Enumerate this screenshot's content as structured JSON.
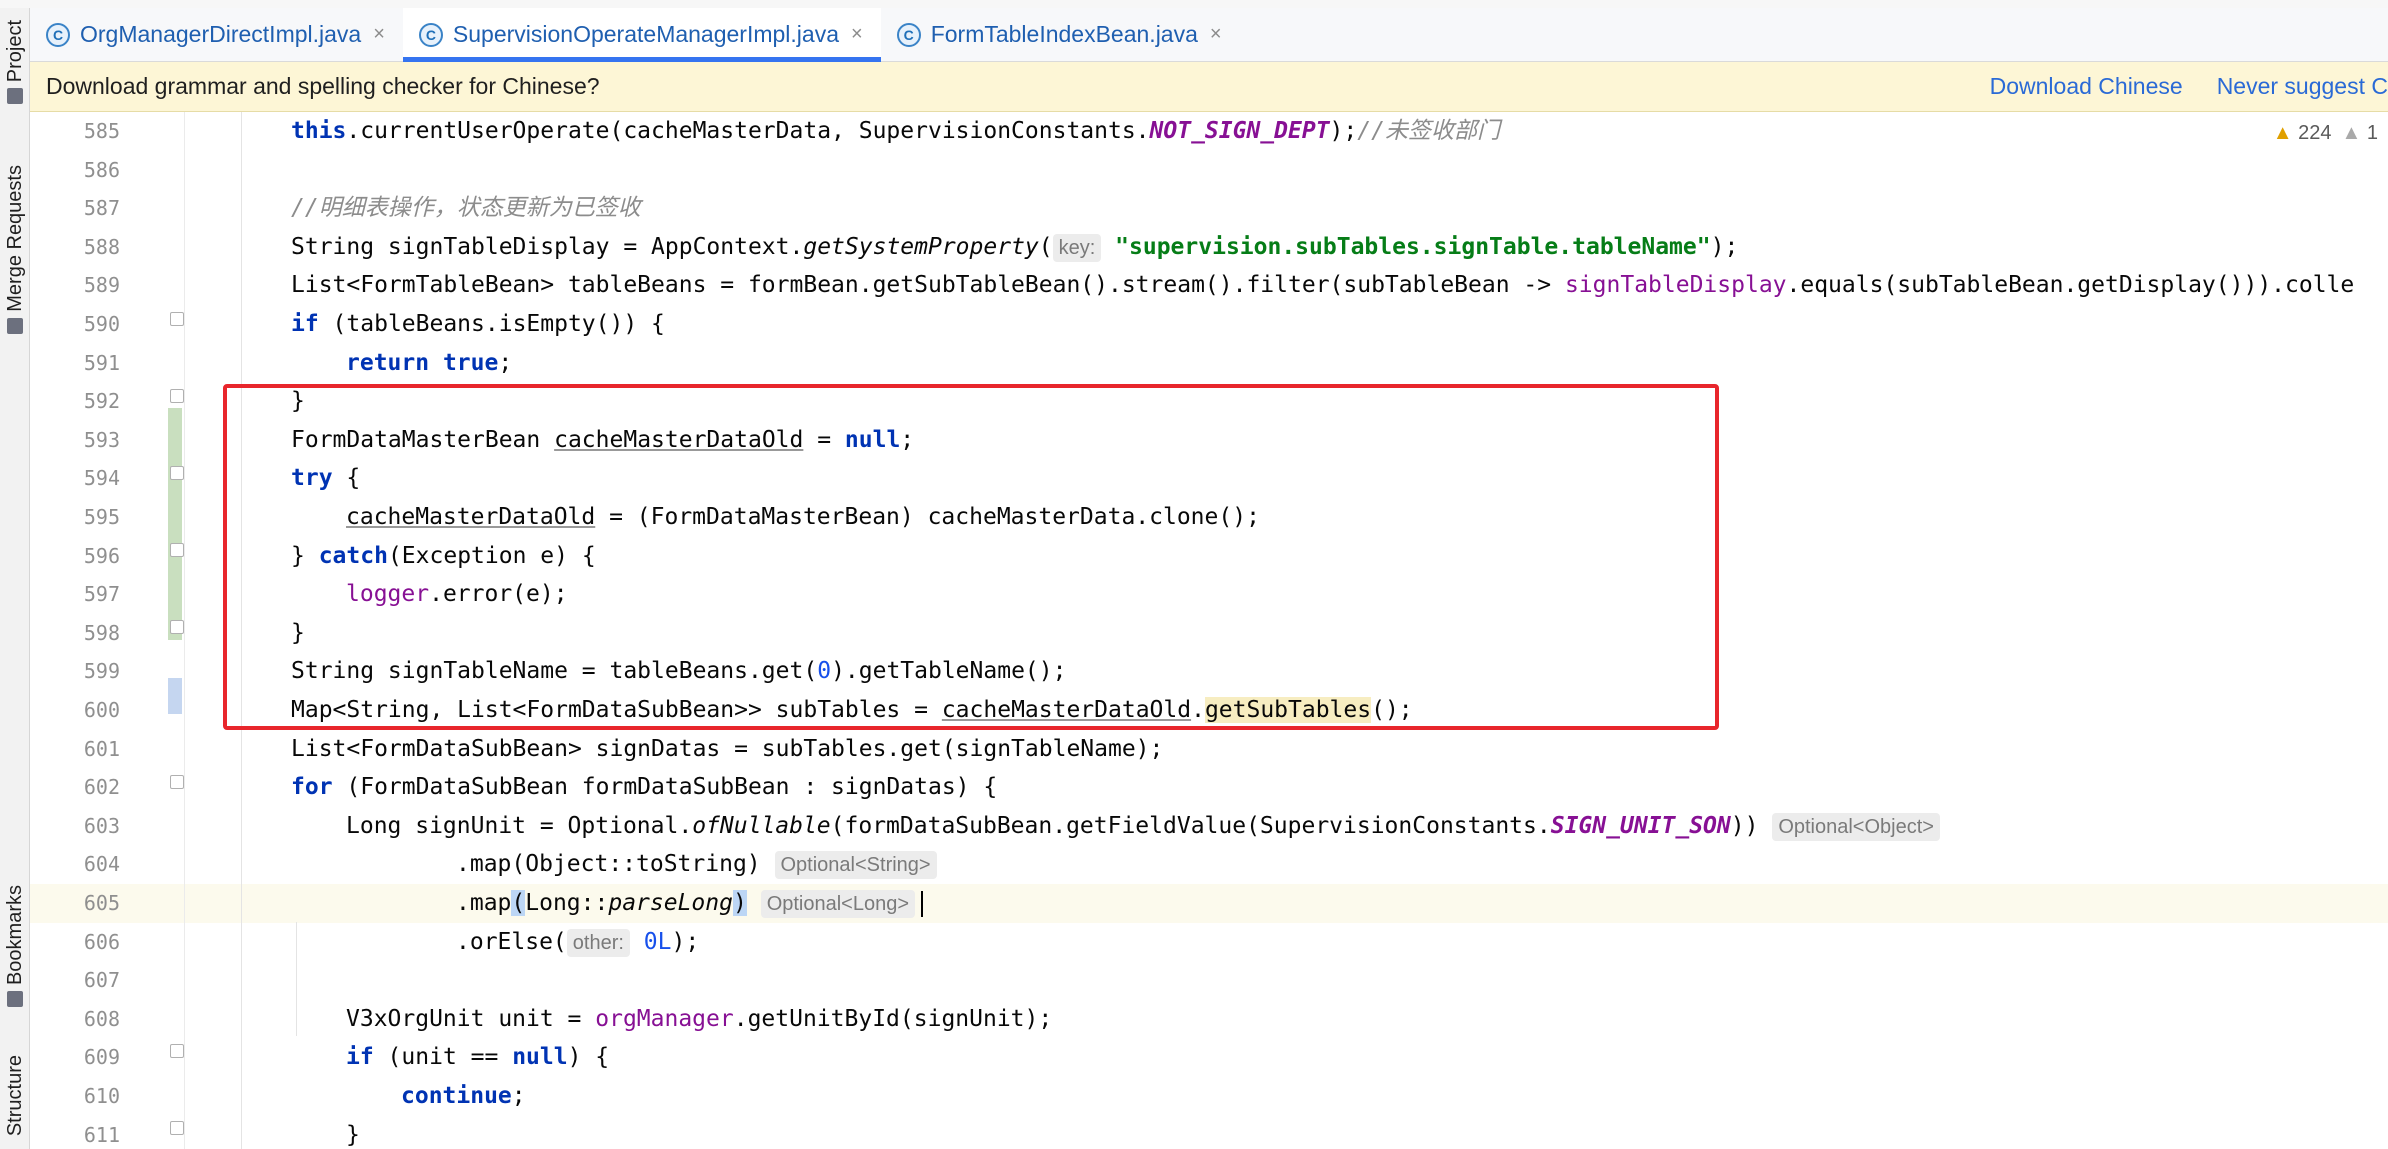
{
  "tabs": [
    {
      "label": "OrgManagerDirectImpl.java",
      "icon_letter": "C",
      "active": false
    },
    {
      "label": "SupervisionOperateManagerImpl.java",
      "icon_letter": "C",
      "active": true
    },
    {
      "label": "FormTableIndexBean.java",
      "icon_letter": "C",
      "active": false
    }
  ],
  "banner": {
    "message": "Download grammar and spelling checker for Chinese?",
    "download_label": "Download Chinese",
    "never_label": "Never suggest C"
  },
  "left_tools": [
    "Project",
    "Merge Requests",
    "Bookmarks",
    "Structure"
  ],
  "inspections": {
    "warnings": "224",
    "weak": "1"
  },
  "code": {
    "line_numbers": [
      "585",
      "586",
      "587",
      "588",
      "589",
      "590",
      "591",
      "592",
      "593",
      "594",
      "595",
      "596",
      "597",
      "598",
      "599",
      "600",
      "601",
      "602",
      "603",
      "604",
      "605",
      "606",
      "607",
      "608",
      "609",
      "610",
      "611"
    ],
    "l585_call": "this",
    "l585_rest": ".currentUserOperate(cacheMasterData, SupervisionConstants.",
    "l585_const": "NOT_SIGN_DEPT",
    "l585_end": ");",
    "l585_comment": "//未签收部门",
    "l587_comment": "//明细表操作，状态更新为已签收",
    "l588_start": "String signTableDisplay = AppContext.",
    "l588_method": "getSystemProperty",
    "l588_open": "(",
    "l588_hint": "key:",
    "l588_str": "\"supervision.subTables.signTable.tableName\"",
    "l588_end": ");",
    "l589_start": "List<FormTableBean> tableBeans = formBean.getSubTableBean().stream().filter(subTableBean -> ",
    "l589_field": "signTableDisplay",
    "l589_end": ".equals(subTableBean.getDisplay())).colle",
    "l590_kw": "if",
    "l590_rest": " (tableBeans.isEmpty()) {",
    "l591_kw1": "return",
    "l591_kw2": "true",
    "l591_end": ";",
    "l592": "}",
    "l593_start": "FormDataMasterBean ",
    "l593_var": "cacheMasterDataOld",
    "l593_mid": " = ",
    "l593_kw": "null",
    "l593_end": ";",
    "l594_kw": "try",
    "l594_end": " {",
    "l595_var": "cacheMasterDataOld",
    "l595_rest": " = (FormDataMasterBean) cacheMasterData.clone();",
    "l596_start": "} ",
    "l596_kw": "catch",
    "l596_rest": "(Exception e) {",
    "l597_field": "logger",
    "l597_rest": ".error(e);",
    "l598": "}",
    "l599_start": "String signTableName = tableBeans.get(",
    "l599_num": "0",
    "l599_end": ").getTableName();",
    "l600_start": "Map<String, List<FormDataSubBean>> subTables = ",
    "l600_var": "cacheMasterDataOld",
    "l600_dot": ".",
    "l600_method": "getSubTables",
    "l600_end": "();",
    "l601": "List<FormDataSubBean> signDatas = subTables.get(signTableName);",
    "l602_kw": "for",
    "l602_rest": " (FormDataSubBean formDataSubBean : signDatas) {",
    "l603_start": "Long signUnit = Optional.",
    "l603_static": "ofNullable",
    "l603_mid": "(formDataSubBean.getFieldValue(SupervisionConstants.",
    "l603_const": "SIGN_UNIT_SON",
    "l603_end": "))",
    "l603_hint": "Optional<Object>",
    "l604_code": ".map(Object::toString)",
    "l604_hint": "Optional<String>",
    "l605_start": ".map",
    "l605_open": "(",
    "l605_mid": "Long::",
    "l605_static": "parseLong",
    "l605_close": ")",
    "l605_hint": "Optional<Long>",
    "l606_start": ".orElse(",
    "l606_hint": "other:",
    "l606_num": "0L",
    "l606_end": ");",
    "l608_start": "V3xOrgUnit unit = ",
    "l608_field": "orgManager",
    "l608_end": ".getUnitById(signUnit);",
    "l609_kw": "if",
    "l609_mid": " (unit == ",
    "l609_kw2": "null",
    "l609_end": ") {",
    "l610_kw": "continue",
    "l610_end": ";",
    "l611": "}"
  },
  "colors": {
    "keyword": "#0033b3",
    "string": "#067d17",
    "comment": "#8c8c8c",
    "constant": "#871094",
    "number": "#1750eb",
    "annotation_box": "#e8262c",
    "banner_bg": "#fdf6d6",
    "link": "#2a6ad6"
  }
}
